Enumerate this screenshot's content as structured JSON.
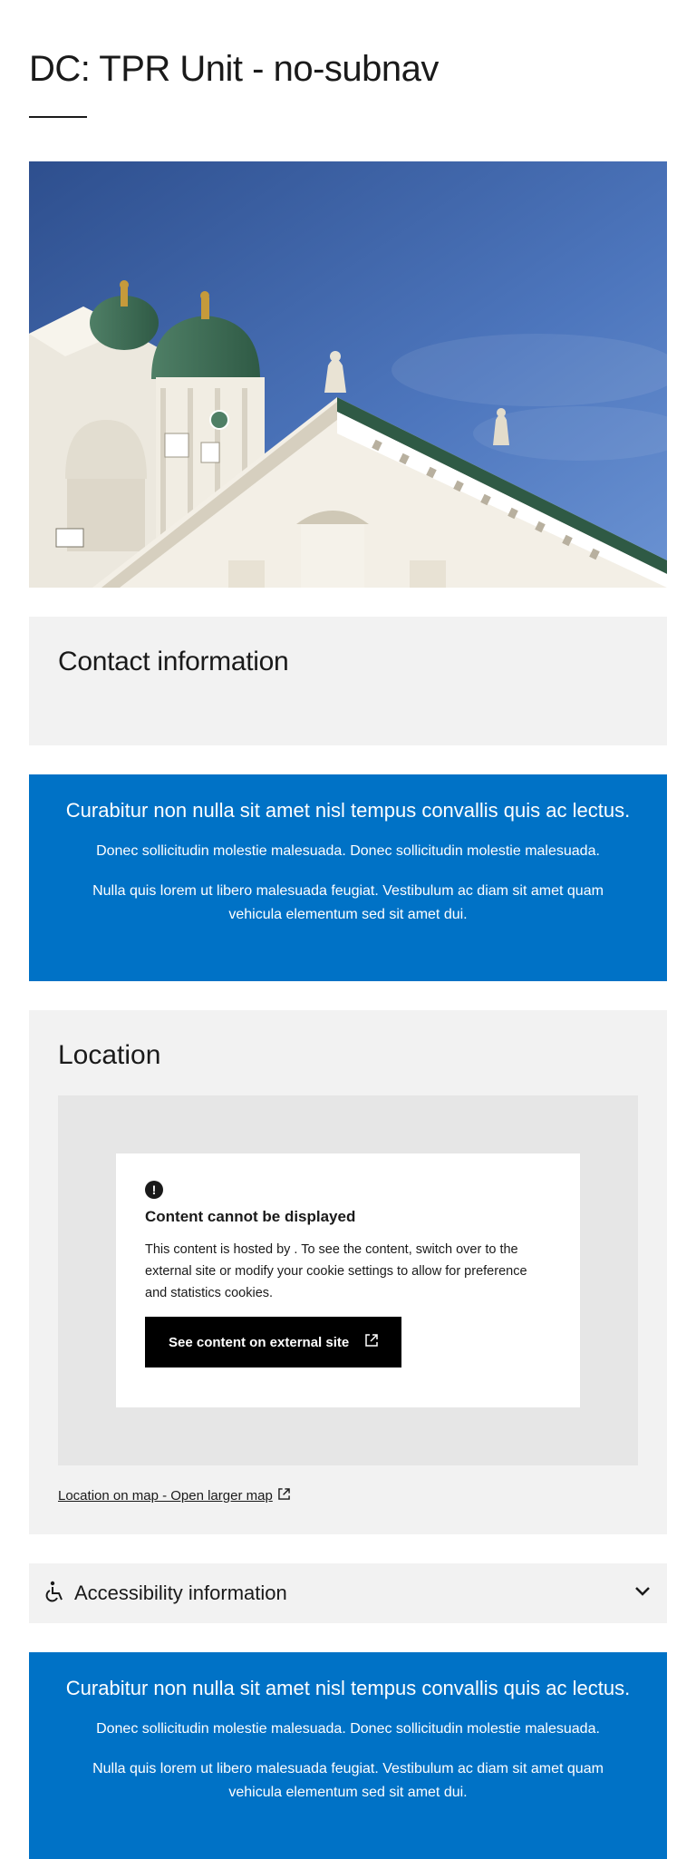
{
  "page_title": "DC: TPR Unit - no-subnav",
  "hero_image": {
    "subject": "Helsinki Cathedral against blue sky"
  },
  "contact": {
    "heading": "Contact information"
  },
  "banners": [
    {
      "heading": "Curabitur non nulla sit amet nisl tempus convallis quis ac lectus.",
      "paragraph_1": "Donec sollicitudin molestie malesuada. Donec sollicitudin molestie malesuada.",
      "paragraph_2": "Nulla quis lorem ut libero malesuada feugiat. Vestibulum ac diam sit amet quam vehicula elementum sed sit amet dui."
    },
    {
      "heading": "Curabitur non nulla sit amet nisl tempus convallis quis ac lectus.",
      "paragraph_1": "Donec sollicitudin molestie malesuada. Donec sollicitudin molestie malesuada.",
      "paragraph_2": "Nulla quis lorem ut libero malesuada feugiat. Vestibulum ac diam sit amet quam vehicula elementum sed sit amet dui."
    }
  ],
  "location": {
    "heading": "Location",
    "notice": {
      "icon": "alert-circle-icon",
      "title": "Content cannot be displayed",
      "body": "This content is hosted by . To see the content, switch over to the external site or modify your cookie settings to allow for preference and statistics cookies.",
      "button_label": "See content on external site"
    },
    "map_link": "Location on map - Open larger map"
  },
  "accessibility": {
    "label": "Accessibility information",
    "icon": "wheelchair-icon"
  },
  "colors": {
    "banner_blue": "#0072c6",
    "panel_grey": "#f2f2f2",
    "map_grey": "#e6e6e6"
  }
}
